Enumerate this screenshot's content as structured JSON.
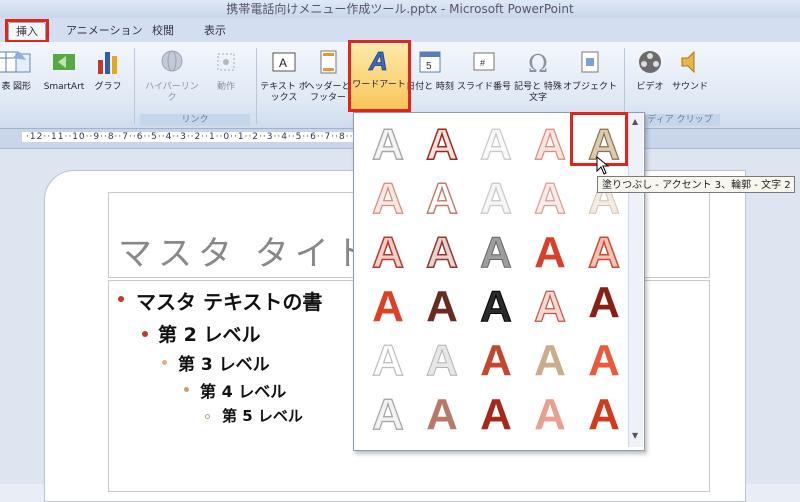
{
  "window": {
    "title": "携帯電話向けメニュー作成ツール.pptx - Microsoft PowerPoint"
  },
  "tabs": [
    "挿入",
    "アニメーション",
    "校閲",
    "表示"
  ],
  "ribbon": {
    "table": "表",
    "picture": "図形",
    "smartart": "SmartArt",
    "chart": "グラフ",
    "hyperlink": "ハイパーリンク",
    "action": "動作",
    "textbox": "テキスト ボックス",
    "headerfooter": "ヘッダーと フッター",
    "wordart": "ワードアート",
    "datetime": "日付と 時刻",
    "slidenumber": "スライド番号",
    "symbol": "記号と 特殊文字",
    "object": "オブジェクト",
    "video": "ビデオ",
    "sound": "サウンド",
    "group_links": "リンク",
    "group_media": "ディア クリップ"
  },
  "ruler": "·12··11··10··9··8··7··6··5··4··3··2··1··0··1··2··3··4··5··6··7··8··9··10··11··12·",
  "slide": {
    "title": "マスタ タイトル",
    "bullets": [
      "マスタ テキストの書",
      "第 2 レベル",
      "第 3 レベル",
      "第 4 レベル",
      "第 5 レベル"
    ]
  },
  "gallery": {
    "glyph": "A"
  },
  "tooltip": "塗りつぶし - アクセント 3、輪郭 - 文字 2",
  "colors": {
    "accent_red": "#e0261c",
    "wordart_dark": "#8b1e14"
  }
}
